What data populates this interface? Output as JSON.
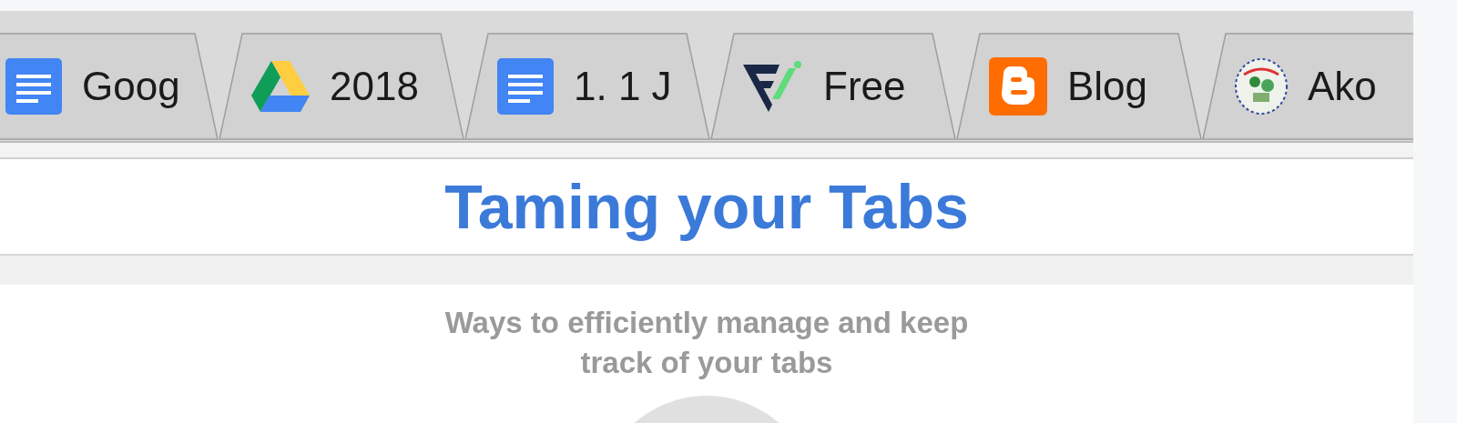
{
  "tabs": [
    {
      "label": "Goog",
      "kind": "docs"
    },
    {
      "label": "2018",
      "kind": "drive"
    },
    {
      "label": "1. 1 J",
      "kind": "docs"
    },
    {
      "label": "Free",
      "kind": "logo"
    },
    {
      "label": "Blog",
      "kind": "blogger"
    },
    {
      "label": "Ako",
      "kind": "seal"
    }
  ],
  "header": {
    "title": "Taming your Tabs"
  },
  "intro": {
    "subtitle": "Ways to efficiently manage and keep track of your tabs"
  }
}
